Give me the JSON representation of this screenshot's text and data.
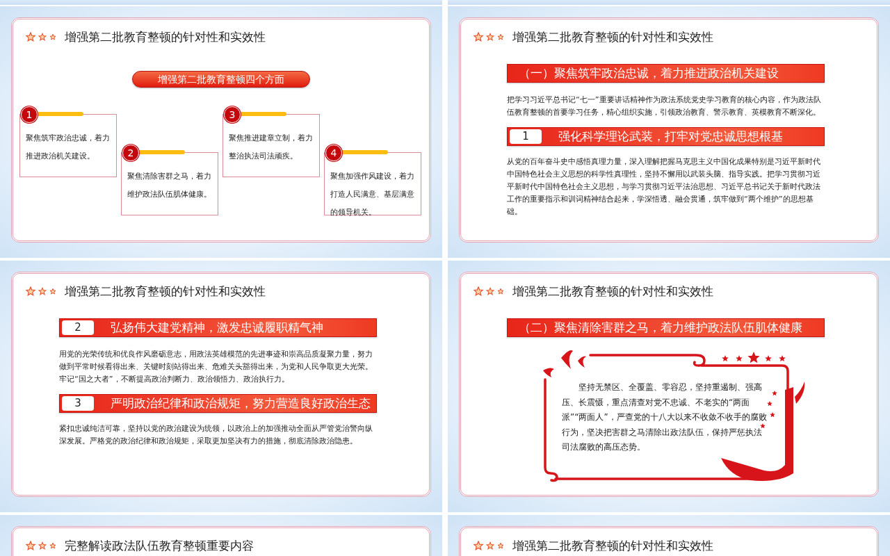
{
  "slides": [
    {
      "kind": "aspects",
      "title": "增强第二批教育整顿的针对性和实效性",
      "banner": "增强第二批教育整顿四个方面",
      "items": [
        {
          "number": "1",
          "text": "聚焦筑牢政治忠诚，着力推进政治机关建设。"
        },
        {
          "number": "2",
          "text": "聚焦清除害群之马，着力维护政法队伍肌体健康。"
        },
        {
          "number": "3",
          "text": "聚焦推进建章立制，着力整治执法司法顽疾。"
        },
        {
          "number": "4",
          "text": "聚焦加强作风建设，着力打造人民满意、基层满意的领导机关。"
        }
      ]
    },
    {
      "kind": "sections",
      "title": "增强第二批教育整顿的针对性和实效性",
      "blocks": [
        {
          "kind": "heading",
          "text": "（一）聚焦筑牢政治忠诚，着力推进政治机关建设"
        },
        {
          "kind": "paragraph",
          "text": "把学习习近平总书记“七一”重要讲话精神作为政法系统党史学习教育的核心内容，作为政法队伍教育整顿的首要学习任务，精心组织实施，引领政治教育、警示教育、英模教育不断深化。"
        },
        {
          "kind": "numbered_heading",
          "number": "1",
          "text": "强化科学理论武装，打牢对党忠诚思想根基"
        },
        {
          "kind": "paragraph",
          "text": "从党的百年奋斗史中感悟真理力量，深入理解把握马克思主义中国化成果特别是习近平新时代中国特色社会主义思想的科学性真理性，坚持不懈用以武装头脑、指导实践。把学习贯彻习近平新时代中国特色社会主义思想，与学习贯彻习近平法治思想、习近平总书记关于新时代政法工作的重要指示和训词精神结合起来，学深悟透、融会贯通，筑牢做到“两个维护”的思想基础。"
        }
      ]
    },
    {
      "kind": "sections",
      "title": "增强第二批教育整顿的针对性和实效性",
      "blocks": [
        {
          "kind": "numbered_heading",
          "number": "2",
          "text": "弘扬伟大建党精神，激发忠诚履职精气神"
        },
        {
          "kind": "paragraph",
          "text": "用党的光荣传统和优良作风磨砺意志，用政法英雄模范的先进事迹和崇高品质凝聚力量，努力做到平常时候看得出来、关键时刻站得出来、危难关头豁得出来，为党和人民争取更大光荣。牢记“国之大者”，不断提高政治判断力、政治领悟力、政治执行力。"
        },
        {
          "kind": "numbered_heading",
          "number": "3",
          "text": "严明政治纪律和政治规矩，努力营造良好政治生态"
        },
        {
          "kind": "paragraph",
          "text": "紧扣忠诚纯洁可靠，坚持以党的政治建设为统领，以政治上的加强推动全面从严管党治警向纵深发展。严格党的政治纪律和政治规矩，采取更加坚决有力的措施，彻底清除政治隐患。"
        }
      ]
    },
    {
      "kind": "framed",
      "title": "增强第二批教育整顿的针对性和实效性",
      "heading": "（二）聚焦清除害群之马，着力维护政法队伍肌体健康",
      "text": "坚持无禁区、全覆盖、零容忍，坚持重遏制、强高压、长震慑，重点清查对党不忠诚、不老实的“两面派”“两面人”，严查党的十八大以来不收敛不收手的腐败行为，坚决把害群之马清除出政法队伍，保持严惩执法司法腐败的高压态势。"
    },
    {
      "kind": "sections",
      "title": "完整解读政法队伍教育整顿重要内容"
    },
    {
      "kind": "sections",
      "title": "增强第二批教育整顿的针对性和实效性"
    }
  ]
}
